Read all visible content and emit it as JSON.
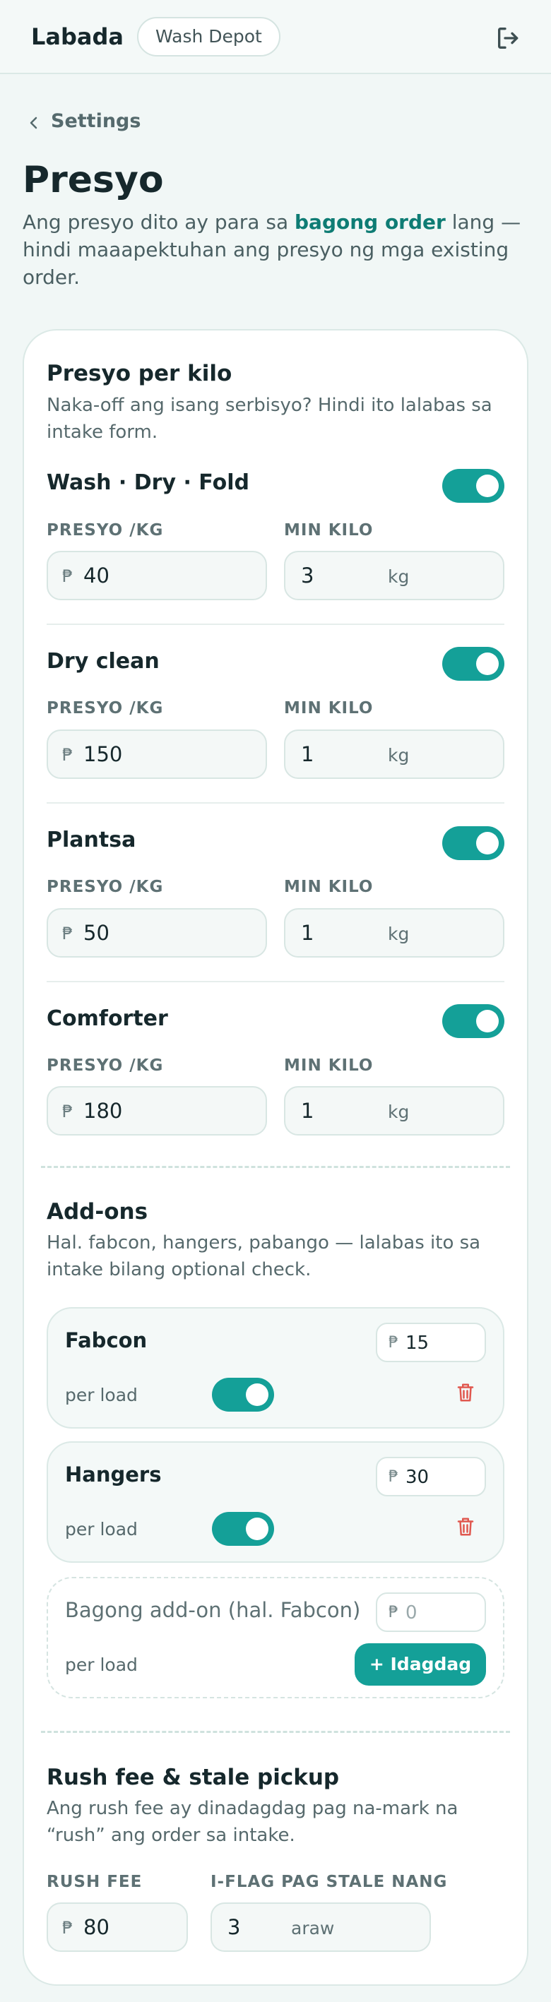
{
  "header": {
    "brand": "Labada",
    "shop": "Wash Depot",
    "logout_icon": "logout-icon"
  },
  "nav": {
    "back_label": "Settings"
  },
  "page": {
    "title": "Presyo",
    "lead_pre": "Ang presyo dito ay para sa ",
    "lead_bold": "bagong order",
    "lead_post": " lang — hindi maaapektuhan ang presyo ng mga existing order."
  },
  "per_kilo": {
    "title": "Presyo per kilo",
    "desc": "Naka-off ang isang serbisyo? Hindi ito lalabas sa intake form.",
    "price_label": "PRESYO /KG",
    "min_label": "MIN KILO",
    "currency": "₱",
    "unit": "kg",
    "services": [
      {
        "name": "Wash · Dry · Fold",
        "price": "40",
        "min": "3",
        "enabled": true
      },
      {
        "name": "Dry clean",
        "price": "150",
        "min": "1",
        "enabled": true
      },
      {
        "name": "Plantsa",
        "price": "50",
        "min": "1",
        "enabled": true
      },
      {
        "name": "Comforter",
        "price": "180",
        "min": "1",
        "enabled": true
      }
    ]
  },
  "addons": {
    "title": "Add-ons",
    "desc": "Hal. fabcon, hangers, pabango — lalabas ito sa intake bilang optional check.",
    "currency": "₱",
    "items": [
      {
        "name": "Fabcon",
        "price": "15",
        "per": "per load",
        "enabled": true
      },
      {
        "name": "Hangers",
        "price": "30",
        "per": "per load",
        "enabled": true
      }
    ],
    "new_item": {
      "name_placeholder": "Bagong add-on (hal. Fabcon)",
      "price_placeholder": "0",
      "per": "per load",
      "add_label": "+ Idagdag"
    }
  },
  "rush": {
    "title": "Rush fee & stale pickup",
    "desc": "Ang rush fee ay dinadagdag pag na-mark na “rush” ang order sa intake.",
    "fee_label": "RUSH FEE",
    "fee_value": "80",
    "stale_label": "I-FLAG PAG STALE NANG",
    "stale_value": "3",
    "stale_unit": "araw",
    "currency": "₱"
  },
  "colors": {
    "accent": "#14a098",
    "accent_text": "#0e7c74",
    "danger": "#e0584f",
    "bg": "#f1f7f6"
  }
}
